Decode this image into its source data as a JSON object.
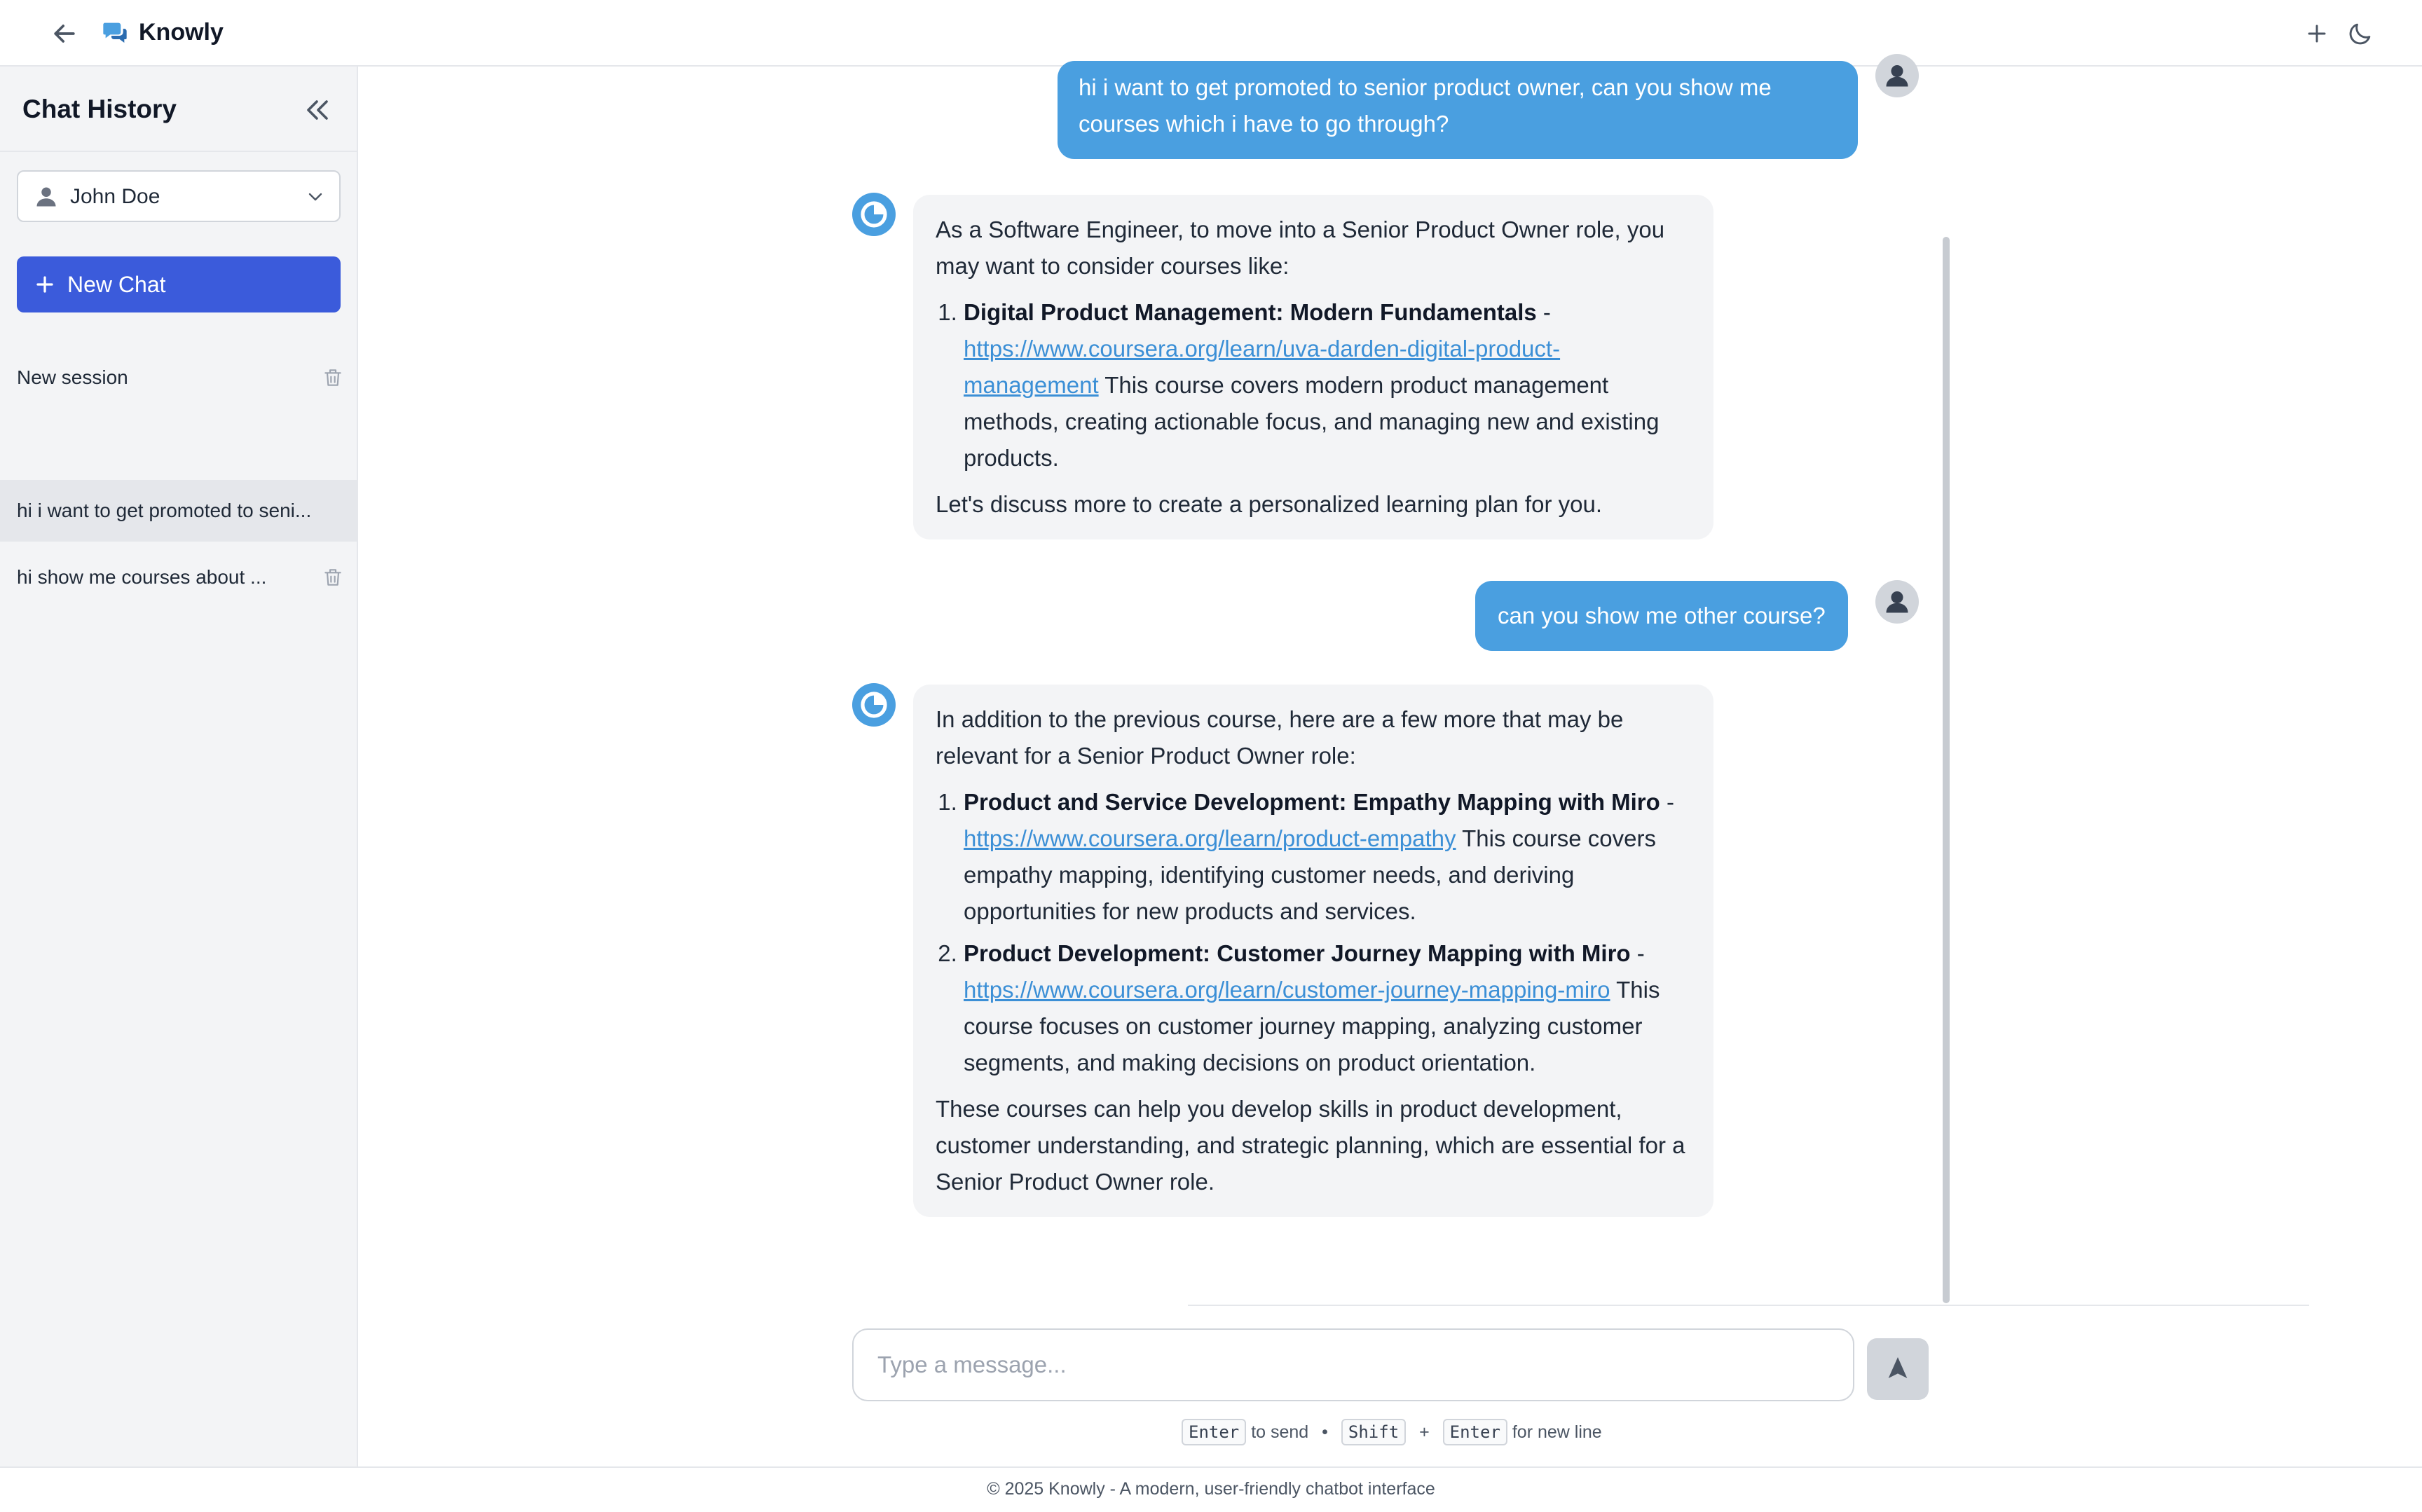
{
  "app": {
    "brand": "Knowly"
  },
  "icons": {
    "back": "arrow-left-icon",
    "logo": "chat-bubbles-icon",
    "new": "plus-icon",
    "theme": "moon-icon",
    "collapse": "double-chevron-left-icon",
    "user": "person-icon",
    "dropdown": "chevron-down-icon",
    "delete": "trash-icon",
    "bot": "pie-chart-icon",
    "send": "send-arrow-icon"
  },
  "colors": {
    "accent": "#4a9fe0",
    "primary_button": "#3b5bdb",
    "bubble_bot": "#f3f4f6"
  },
  "sidebar": {
    "title": "Chat History",
    "user": "John Doe",
    "new_chat": "New Chat",
    "sessions": [
      {
        "label": "New session"
      },
      {
        "label": "hi i want to get promoted to seni..."
      },
      {
        "label": "hi show me courses about ..."
      }
    ]
  },
  "chat": {
    "m1": {
      "text": "hi i want to get promoted to senior product owner, can you show me courses which i have to go through?"
    },
    "m2": {
      "intro": "As a Software Engineer, to move into a Senior Product Owner role, you may want to consider courses like:",
      "items": [
        {
          "title": "Digital Product Management: Modern Fundamentals",
          "dash": " - ",
          "link": "https://www.coursera.org/learn/uva-darden-digital-product-management",
          "desc": " This course covers modern product management methods, creating actionable focus, and managing new and existing products."
        }
      ],
      "outro": "Let's discuss more to create a personalized learning plan for you."
    },
    "m3": {
      "text": "can you show me other course?"
    },
    "m4": {
      "intro": "In addition to the previous course, here are a few more that may be relevant for a Senior Product Owner role:",
      "items": [
        {
          "title": "Product and Service Development: Empathy Mapping with Miro",
          "dash": " - ",
          "link": "https://www.coursera.org/learn/product-empathy",
          "desc": " This course covers empathy mapping, identifying customer needs, and deriving opportunities for new products and services."
        },
        {
          "title": "Product Development: Customer Journey Mapping with Miro",
          "dash": " - ",
          "link": "https://www.coursera.org/learn/customer-journey-mapping-miro",
          "desc": " This course focuses on customer journey mapping, analyzing customer segments, and making decisions on product orientation."
        }
      ],
      "outro": "These courses can help you develop skills in product development, customer understanding, and strategic planning, which are essential for a Senior Product Owner role."
    }
  },
  "input": {
    "placeholder": "Type a message...",
    "value": ""
  },
  "hint": {
    "enter": "Enter",
    "to_send": "to send",
    "bullet": "•",
    "shift": "Shift",
    "plus": "+",
    "enter2": "Enter",
    "new_line": "for new line"
  },
  "footer": {
    "text": "© 2025 Knowly - A modern, user-friendly chatbot interface"
  }
}
